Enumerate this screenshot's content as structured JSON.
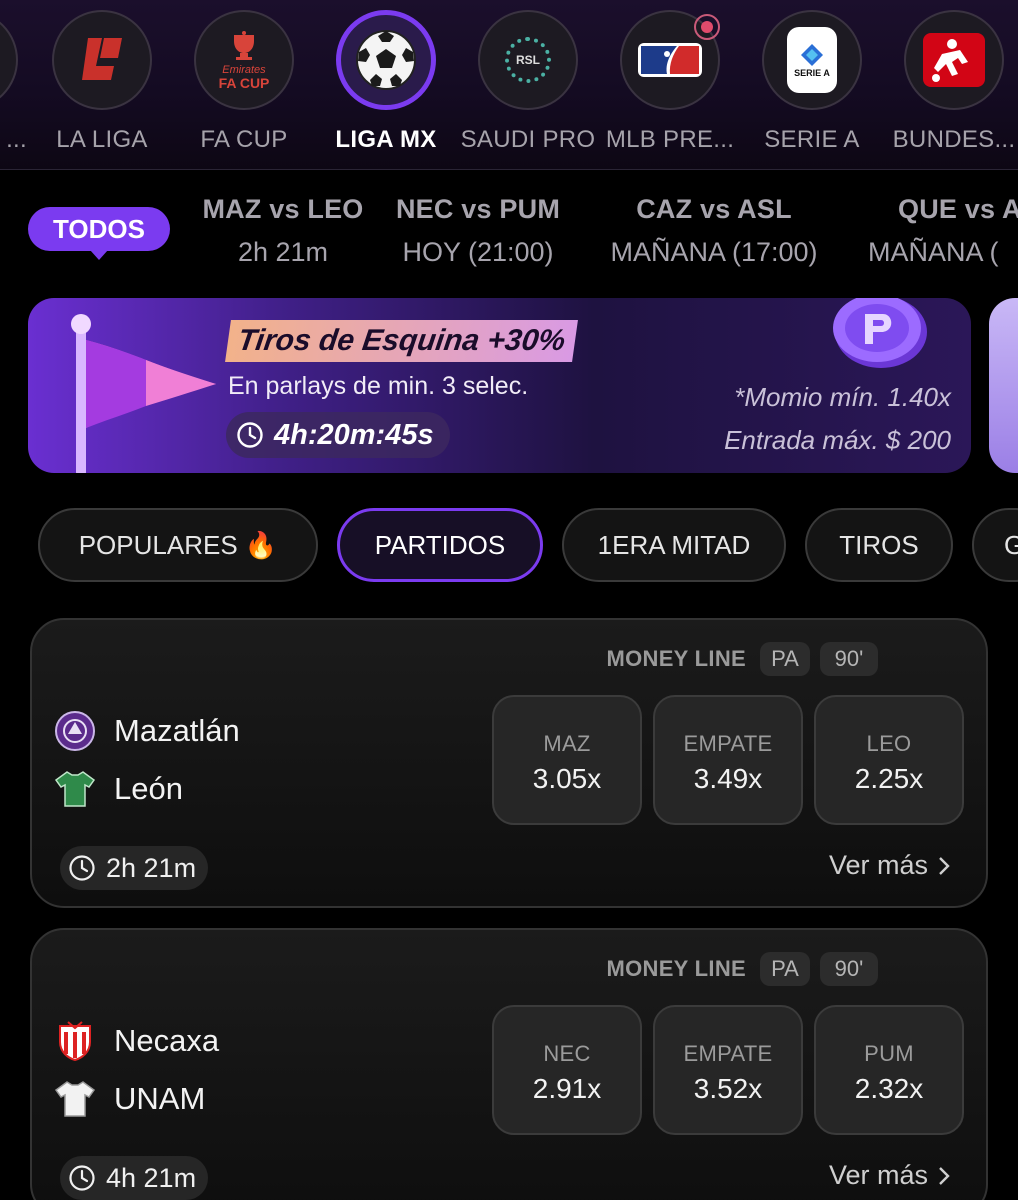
{
  "leagues": [
    {
      "name": "D ...",
      "icon": "league-logo-icon"
    },
    {
      "name": "LA LIGA",
      "icon": "laliga-logo-icon"
    },
    {
      "name": "FA CUP",
      "icon": "fa-cup-logo-icon",
      "logo_text_1": "Emirates",
      "logo_text_2": "FA CUP"
    },
    {
      "name": "LIGA MX",
      "icon": "soccer-ball-icon",
      "active": true
    },
    {
      "name": "SAUDI PRO",
      "icon": "rsl-logo-icon",
      "logo_text": "RSL"
    },
    {
      "name": "MLB PRE...",
      "icon": "mlb-logo-icon",
      "notification": true
    },
    {
      "name": "SERIE A",
      "icon": "serie-a-logo-icon",
      "logo_text": "SERIE A"
    },
    {
      "name": "BUNDES...",
      "icon": "bundesliga-logo-icon"
    }
  ],
  "match_tabs": {
    "todos": "TODOS",
    "items": [
      {
        "title": "MAZ vs LEO",
        "time": "2h 21m"
      },
      {
        "title": "NEC vs PUM",
        "time": "HOY (21:00)"
      },
      {
        "title": "CAZ vs ASL",
        "time": "MAÑANA (17:00)"
      },
      {
        "title": "QUE vs A",
        "time": "MAÑANA ("
      }
    ]
  },
  "promo": {
    "title": "Tiros de Esquina +30%",
    "subtitle": "En parlays de min. 3 selec.",
    "timer": "4h:20m:45s",
    "note_1": "*Momio mín. 1.40x",
    "note_2": "Entrada máx. $ 200"
  },
  "categories": [
    {
      "label": "POPULARES 🔥"
    },
    {
      "label": "PARTIDOS",
      "active": true
    },
    {
      "label": "1ERA MITAD"
    },
    {
      "label": "TIROS"
    },
    {
      "label": "G"
    }
  ],
  "matches": [
    {
      "market": "MONEY LINE",
      "badge_1": "PA",
      "badge_2": "90'",
      "home": "Mazatlán",
      "away": "León",
      "home_icon": "mazatlan-crest-icon",
      "away_icon": "green-jersey-icon",
      "odds": [
        {
          "label": "MAZ",
          "value": "3.05x"
        },
        {
          "label": "EMPATE",
          "value": "3.49x"
        },
        {
          "label": "LEO",
          "value": "2.25x"
        }
      ],
      "time": "2h 21m",
      "more": "Ver más"
    },
    {
      "market": "MONEY LINE",
      "badge_1": "PA",
      "badge_2": "90'",
      "home": "Necaxa",
      "away": "UNAM",
      "home_icon": "necaxa-crest-icon",
      "away_icon": "white-jersey-icon",
      "odds": [
        {
          "label": "NEC",
          "value": "2.91x"
        },
        {
          "label": "EMPATE",
          "value": "3.52x"
        },
        {
          "label": "PUM",
          "value": "2.32x"
        }
      ],
      "time": "4h 21m",
      "more": "Ver más"
    }
  ],
  "colors": {
    "accent": "#7b3bf0",
    "background": "#000000",
    "card": "#1b1b1b"
  }
}
